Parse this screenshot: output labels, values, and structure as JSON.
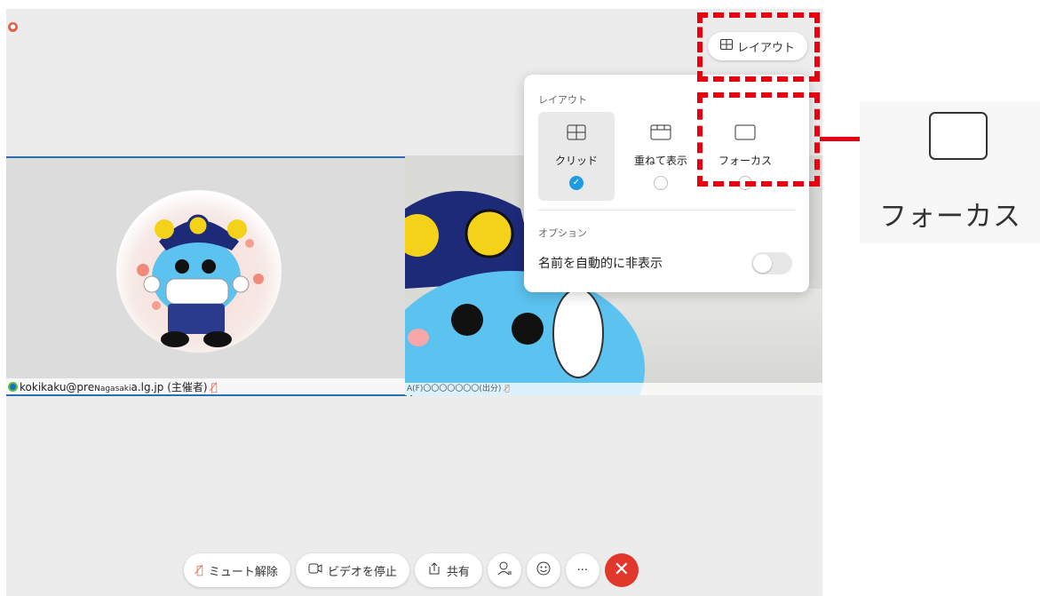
{
  "meeting": {
    "participants": [
      {
        "name_prefix": "kokikaku@pre",
        "name_overlay": "Nagasaki",
        "name_suffix": "a.lg.jp (主催者)"
      },
      {
        "name": "A(F)〇〇〇〇〇〇〇(出分)"
      }
    ]
  },
  "layout_button": {
    "label": "レイアウト",
    "icon": "grid-icon"
  },
  "layout_panel": {
    "title": "レイアウト",
    "options": [
      {
        "label": "クリッド",
        "selected": true,
        "icon": "grid-layout-icon"
      },
      {
        "label": "重ねて表示",
        "selected": false,
        "icon": "stacked-layout-icon"
      },
      {
        "label": "フォーカス",
        "selected": false,
        "icon": "focus-layout-icon"
      }
    ],
    "options_title": "オプション",
    "auto_hide_names": {
      "label": "名前を自動的に非表示",
      "enabled": false
    }
  },
  "callout": {
    "label": "フォーカス"
  },
  "controls": {
    "unmute": "ミュート解除",
    "stop_video": "ビデオを停止",
    "share": "共有",
    "more": "···"
  },
  "colors": {
    "highlight": "#e8000e",
    "selected_radio": "#1f9be2",
    "end_call": "#e0382a"
  }
}
